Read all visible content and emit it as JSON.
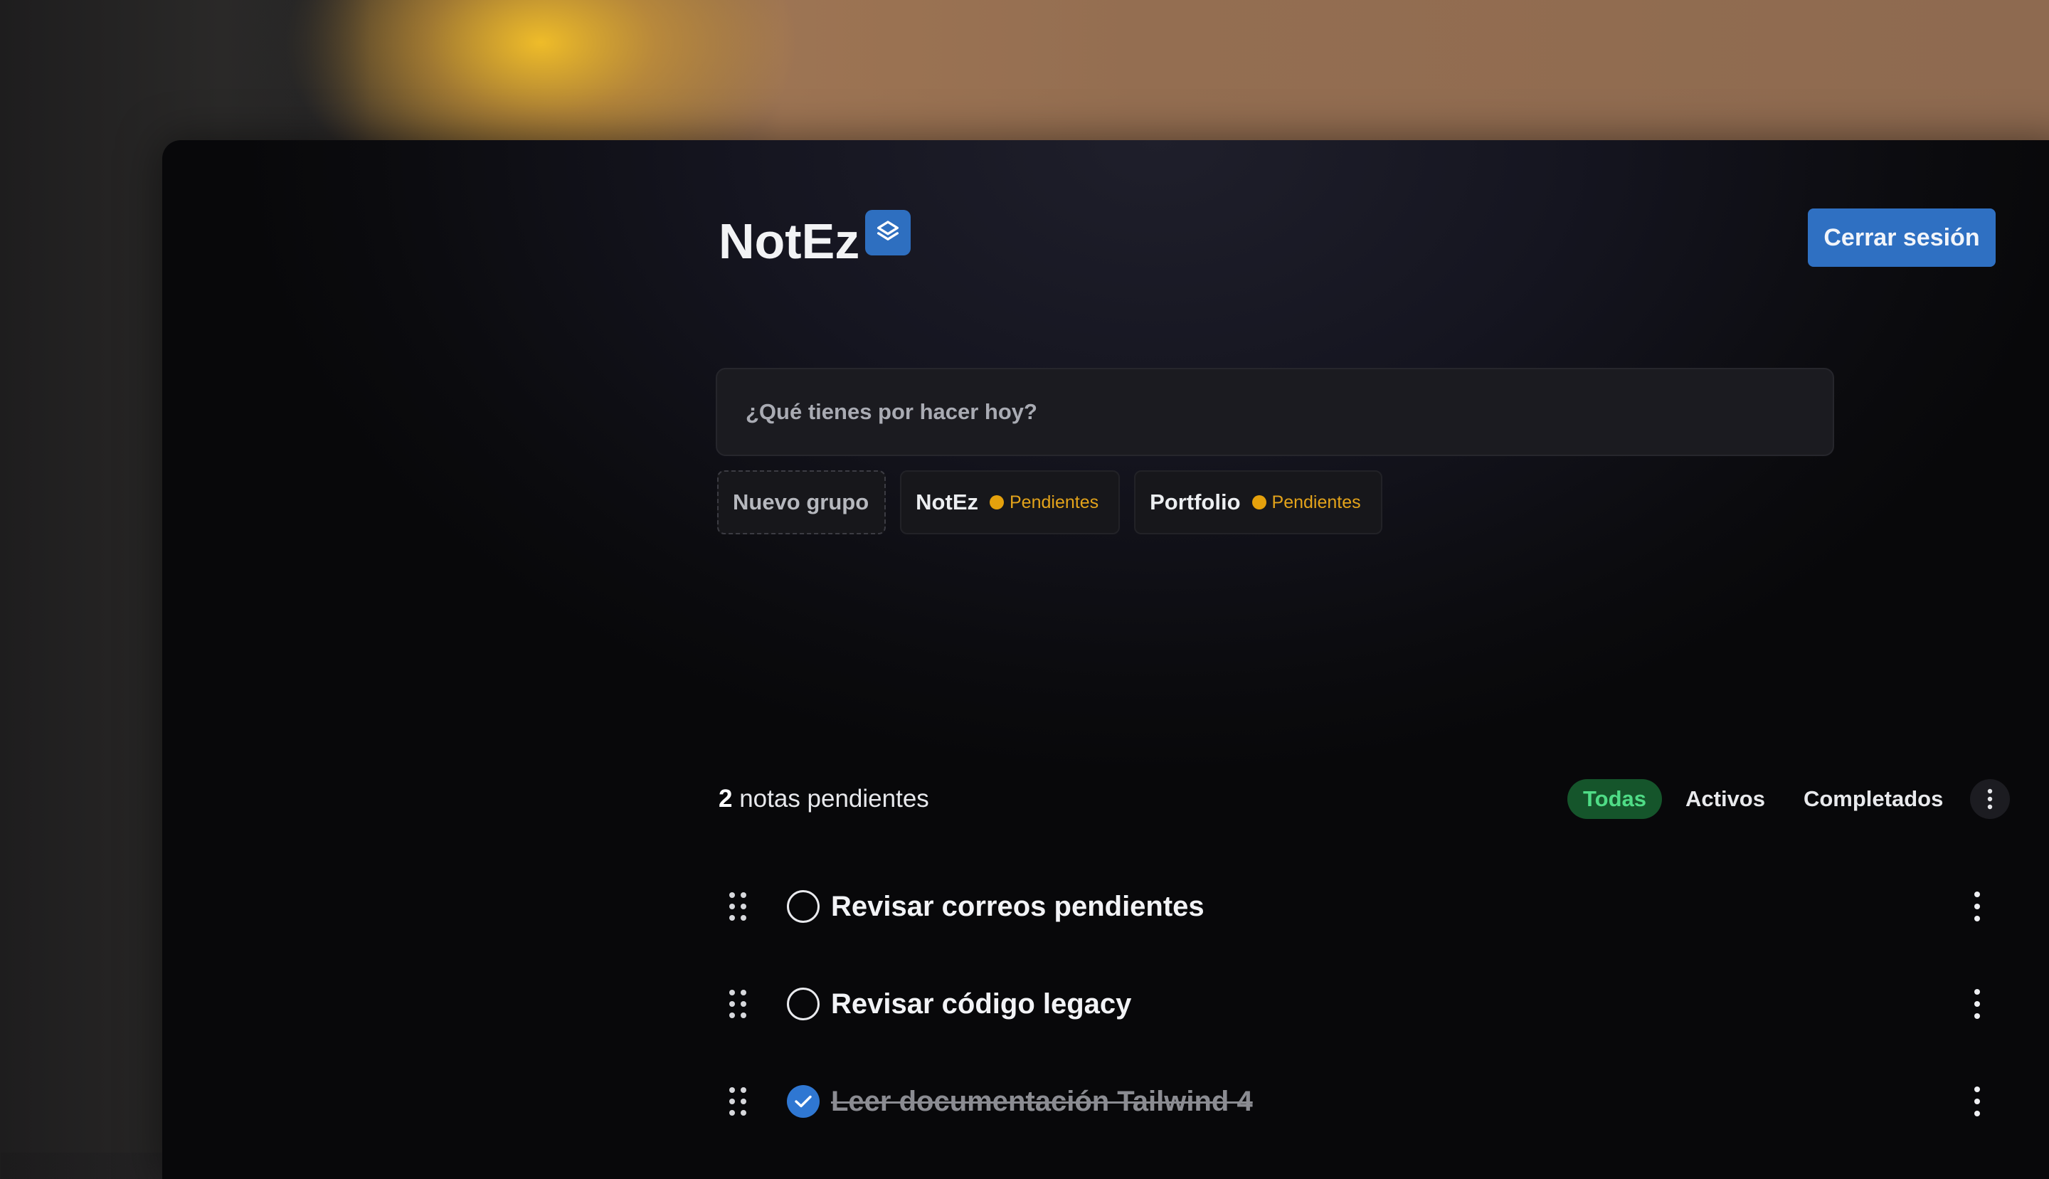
{
  "app": {
    "name": "NotEz",
    "logout_label": "Cerrar sesión"
  },
  "input": {
    "placeholder": "¿Qué tienes por hacer hoy?"
  },
  "groups": {
    "new_label": "Nuevo grupo",
    "items": [
      {
        "name": "NotEz",
        "status": "Pendientes"
      },
      {
        "name": "Portfolio",
        "status": "Pendientes"
      }
    ]
  },
  "summary": {
    "count": "2",
    "label": " notas pendientes"
  },
  "filters": {
    "all": "Todas",
    "active": "Activos",
    "completed": "Completados",
    "selected": "Todas"
  },
  "todos": [
    {
      "text": "Revisar correos pendientes",
      "done": false
    },
    {
      "text": "Revisar código legacy",
      "done": false
    },
    {
      "text": "Leer documentación Tailwind 4",
      "done": true
    }
  ],
  "colors": {
    "accent": "#2f70c2",
    "pending": "#e5a10c",
    "filter_active_bg": "#15552b",
    "filter_active_text": "#4fdc86"
  },
  "icons": {
    "logo": "stack-layers-icon",
    "drag": "drag-handle-icon",
    "more": "more-vertical-icon",
    "check": "check-icon"
  }
}
